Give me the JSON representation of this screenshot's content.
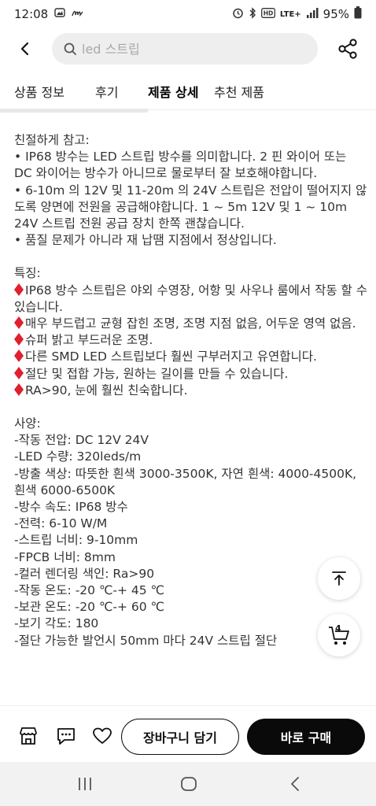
{
  "status_bar": {
    "time": "12:08",
    "battery_percent": "95%",
    "network": "LTE+"
  },
  "search": {
    "placeholder": "led 스트립"
  },
  "tabs": [
    {
      "label": "상품 정보"
    },
    {
      "label": "후기"
    },
    {
      "label": "제품 상세"
    },
    {
      "label": "추천 제품"
    }
  ],
  "active_tab": "제품 상세",
  "content": {
    "note_title": "친절하게 참고:",
    "note_lines": [
      "• IP68 방수는 LED 스트립 방수를 의미합니다. 2 핀 와이어 또는 DC 와이어는 방수가 아니므로 물로부터 잘 보호해야합니다.",
      "• 6-10m 의 12V 및 11-20m 의 24V 스트립은 전압이 떨어지지 않도록 양면에 전원을 공급해야합니다. 1 ~ 5m 12V 및 1 ~ 10m 24V 스트립 전원 공급 장치 한쪽 괜찮습니다.",
      "• 품질 문제가 아니라 재 납땜 지점에서 정상입니다."
    ],
    "features_title": "특징:",
    "features": [
      "IP68 방수 스트립은 야외 수영장, 어항 및 사우나 룸에서 작동 할 수 있습니다.",
      "매우 부드럽고 균형 잡힌 조명, 조명 지점 없음, 어두운 영역 없음.",
      "슈퍼 밝고 부드러운 조명.",
      "다른 SMD LED 스트립보다 훨씬 구부러지고 유연합니다.",
      "절단 및 접합 가능, 원하는 길이를 만들 수 있습니다.",
      "RA>90, 눈에 훨씬 친숙합니다."
    ],
    "specs_title": "사양:",
    "specs": [
      "-작동 전압: DC 12V 24V",
      "-LED 수량: 320leds/m",
      "-방출 색상: 따뜻한 흰색 3000-3500K, 자연 흰색: 4000-4500K, 흰색 6000-6500K",
      "-방수 속도: IP68 방수",
      "-전력: 6-10 W/M",
      "-스트립 너비: 9-10mm",
      "-FPCB 너비: 8mm",
      "-컬러 렌더링 색인: Ra>90",
      "-작동 온도: -20 ℃-+ 45 ℃",
      "-보관 온도: -20 ℃-+ 60 ℃",
      "-보기 각도: 180",
      "-절단 가능한 발언시 50mm 마다 24V 스트립 절단"
    ]
  },
  "fab": {
    "scroll_top_icon": "arrow-up-icon",
    "cart_count": "4"
  },
  "bottom_bar": {
    "store_icon": "store-icon",
    "chat_icon": "chat-icon",
    "wishlist_icon": "heart-icon",
    "add_to_cart_label": "장바구니 담기",
    "buy_now_label": "바로 구매"
  },
  "colors": {
    "accent_dark": "#0a0a0a",
    "diamond_red": "#e0202e"
  }
}
